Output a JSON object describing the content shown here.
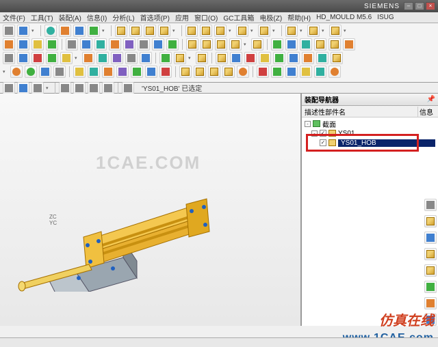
{
  "titlebar": {
    "brand": "SIEMENS"
  },
  "menubar": [
    "文件(F)",
    "工具(T)",
    "装配(A)",
    "信息(I)",
    "分析(L)",
    "首选项(P)",
    "应用",
    "窗口(O)",
    "GC工具箱",
    "电极(Z)",
    "帮助(H)",
    "HD_MOULD M5.6",
    "ISUG"
  ],
  "infobar": {
    "status": "'YS01_HOB' 已选定"
  },
  "navigator": {
    "title": "装配导航器",
    "col1": "描述性部件名",
    "col2": "信息",
    "tree": {
      "root": {
        "label": "截面"
      },
      "asm": {
        "label": "YS01"
      },
      "selected": {
        "label": "YS01_HOB"
      }
    }
  },
  "watermark": {
    "main": "1CAE.COM",
    "url": "www.1CAE.com",
    "cn": "仿真在线"
  },
  "triad": {
    "z": "ZC",
    "y": "YC"
  }
}
